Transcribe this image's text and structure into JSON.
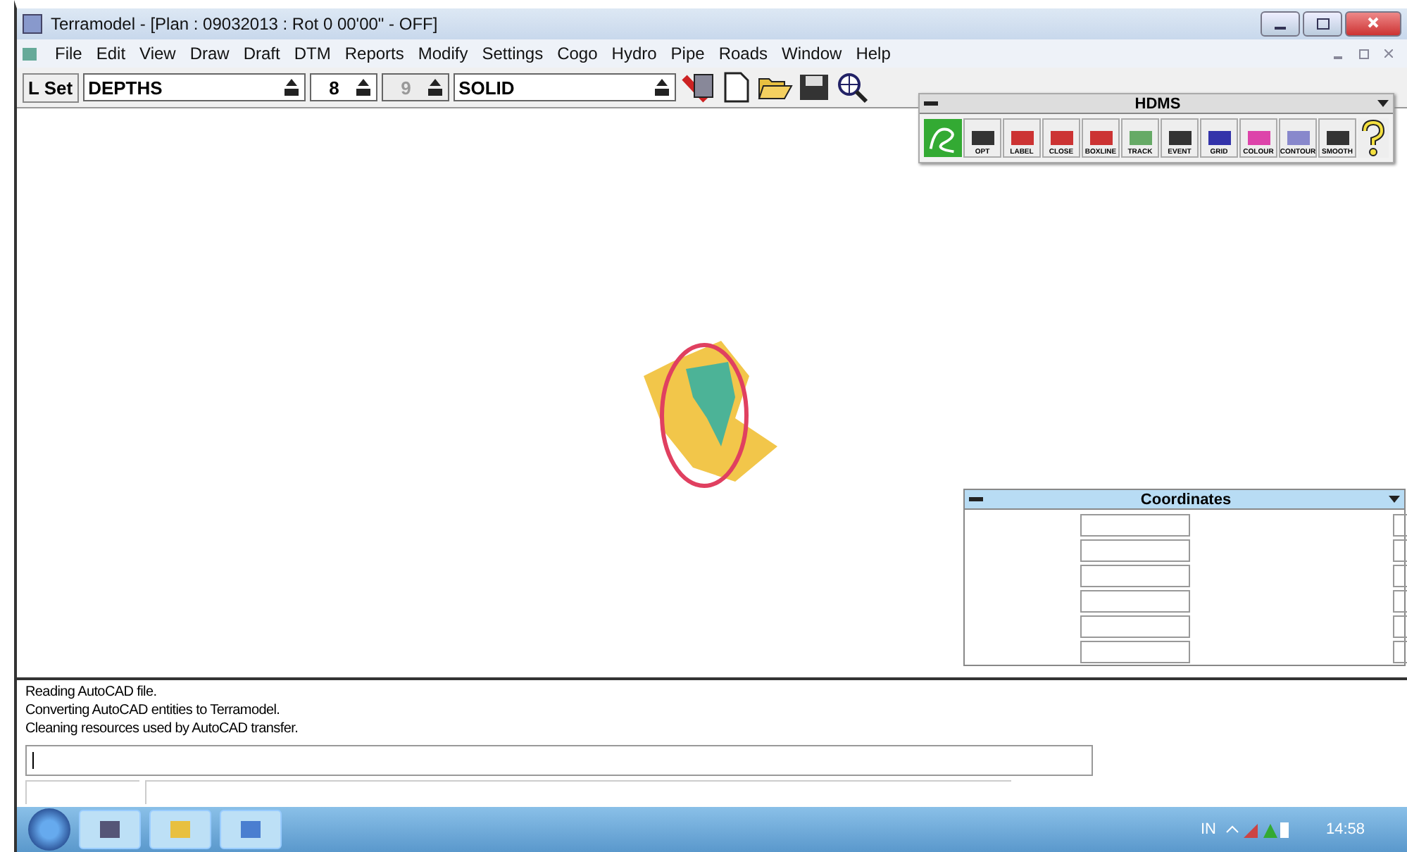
{
  "window": {
    "title": "Terramodel - [Plan : 09032013 : Rot 0 00'00\" - OFF]"
  },
  "menu": [
    "File",
    "Edit",
    "View",
    "Draw",
    "Draft",
    "DTM",
    "Reports",
    "Modify",
    "Settings",
    "Cogo",
    "Hydro",
    "Pipe",
    "Roads",
    "Window",
    "Help"
  ],
  "toolbar": {
    "lset": "L Set",
    "fields": [
      {
        "value": "DEPTHS",
        "disabled": false,
        "kind": "wide"
      },
      {
        "value": "8",
        "disabled": false,
        "kind": "narrow"
      },
      {
        "value": "9",
        "disabled": true,
        "kind": "narrow"
      },
      {
        "value": "SOLID",
        "disabled": false,
        "kind": "wide"
      }
    ]
  },
  "hdms_palette": {
    "title": "HDMS",
    "tools": [
      "OPT",
      "LABEL",
      "CLOSE",
      "BOXLINE",
      "TRACK",
      "EVENT",
      "GRID",
      "COLOUR",
      "CONTOUR",
      "SMOOTH"
    ]
  },
  "coordinates_panel": {
    "title": "Coordinates"
  },
  "messages": [
    "Reading AutoCAD file.",
    "Converting AutoCAD entities to Terramodel.",
    "Cleaning resources used by AutoCAD transfer."
  ],
  "taskbar": {
    "language": "IN",
    "time": "14:58"
  }
}
